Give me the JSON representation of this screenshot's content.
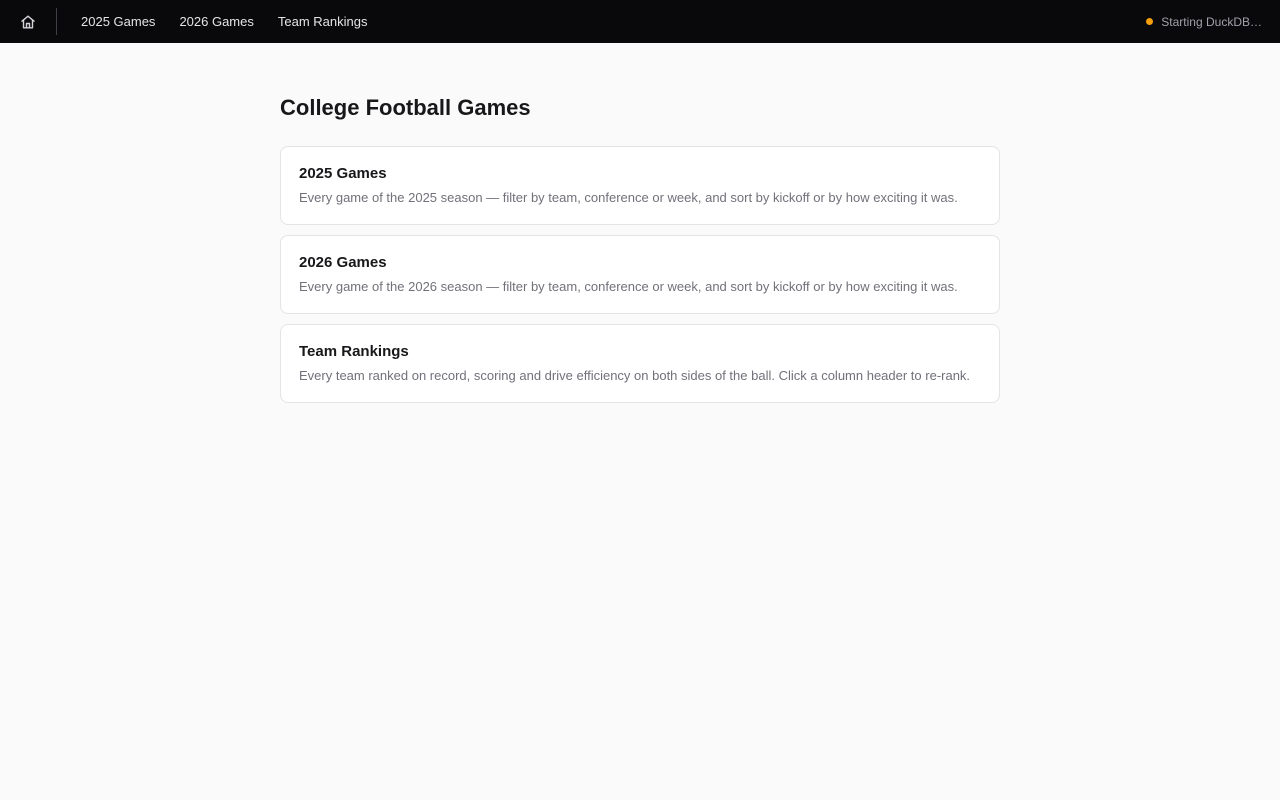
{
  "nav": {
    "home_icon": "home-icon",
    "links": [
      "2025 Games",
      "2026 Games",
      "Team Rankings"
    ],
    "status": {
      "text": "Starting DuckDB…",
      "color": "#f59e0b"
    }
  },
  "main": {
    "title": "College Football Games",
    "cards": [
      {
        "title": "2025 Games",
        "description": "Every game of the 2025 season — filter by team, conference or week, and sort by kickoff or by how exciting it was."
      },
      {
        "title": "2026 Games",
        "description": "Every game of the 2026 season — filter by team, conference or week, and sort by kickoff or by how exciting it was."
      },
      {
        "title": "Team Rankings",
        "description": "Every team ranked on record, scoring and drive efficiency on both sides of the ball. Click a column header to re-rank."
      }
    ]
  }
}
